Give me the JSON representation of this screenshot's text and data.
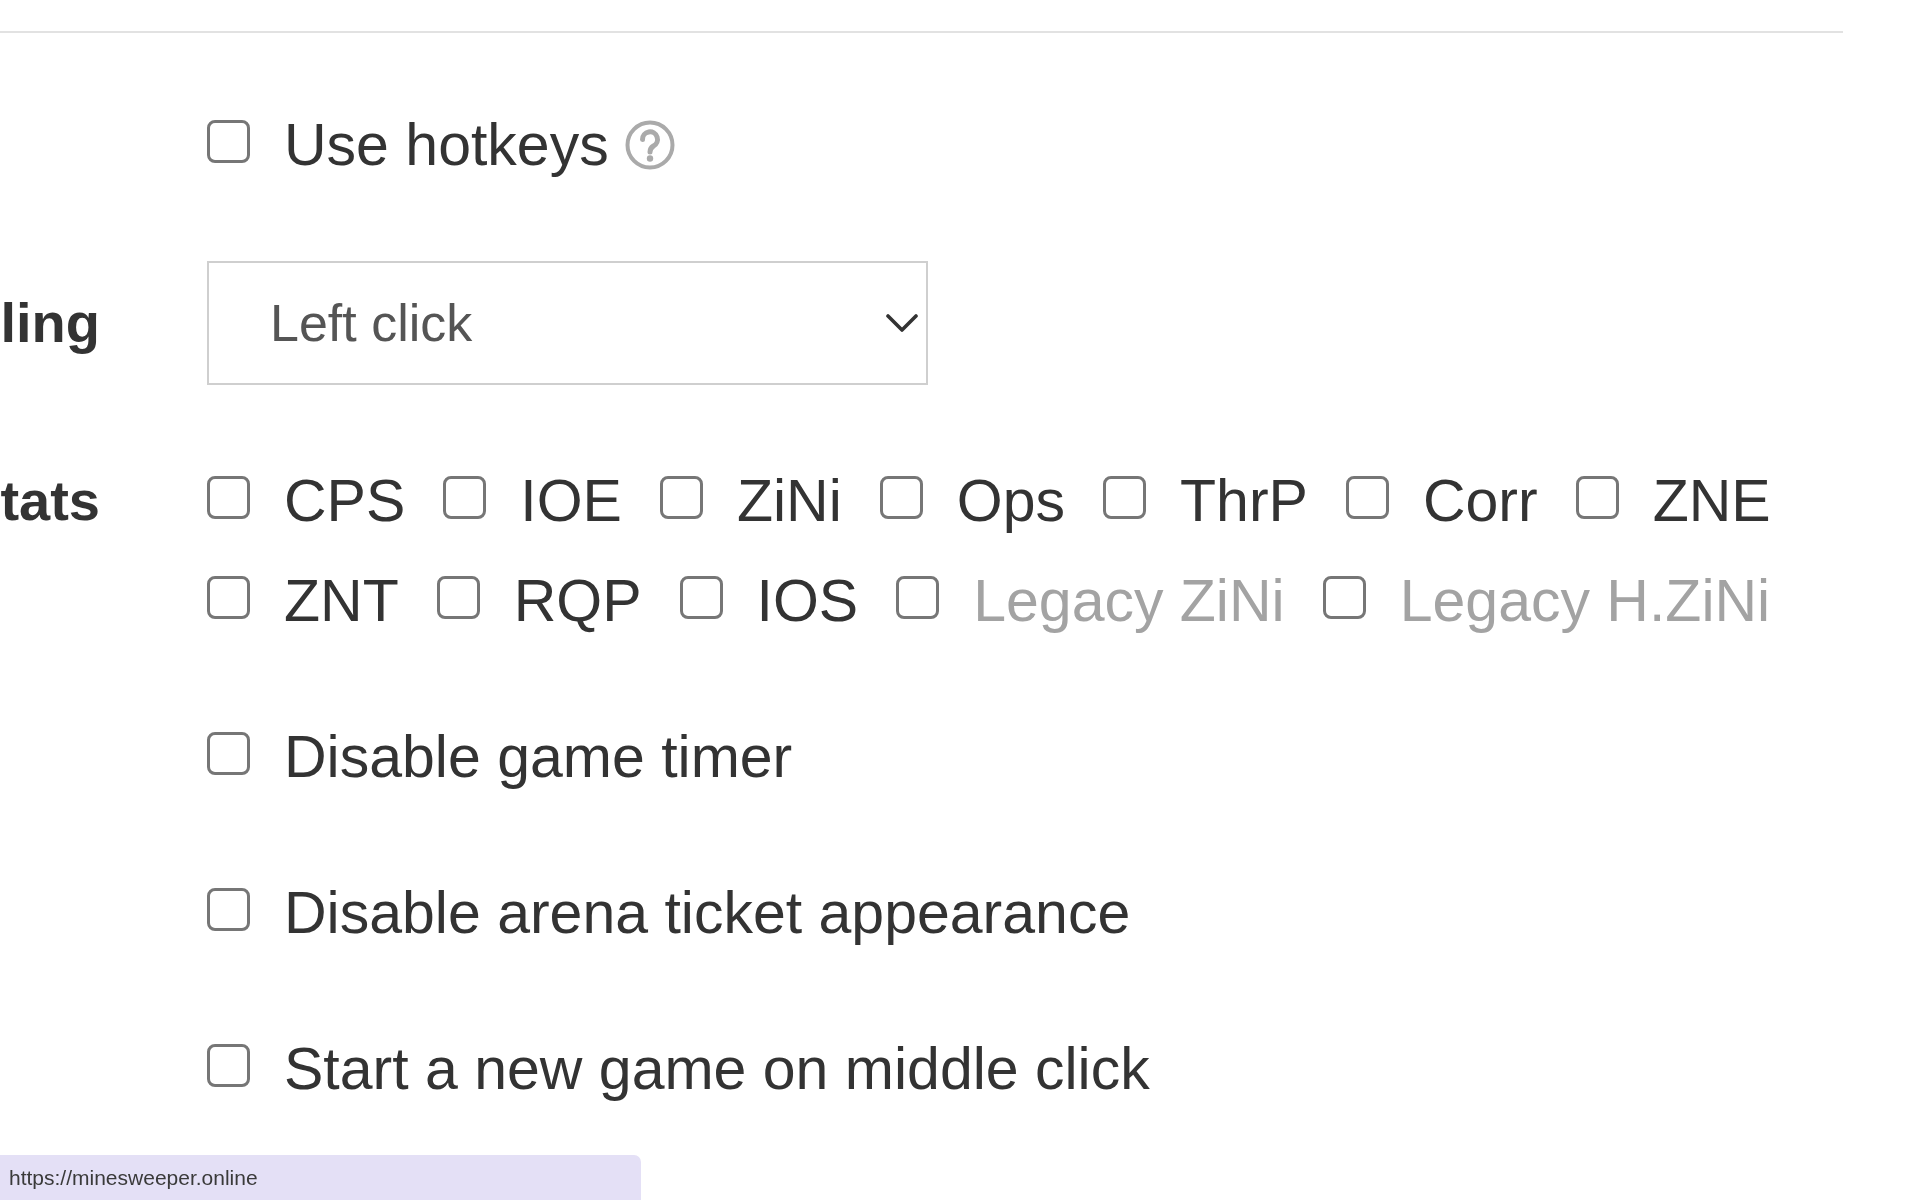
{
  "form": {
    "rows": [
      {
        "kind": "checkbox",
        "option": {
          "text": "Use hotkeys",
          "checked": false,
          "disabled": false
        },
        "help": true
      },
      {
        "kind": "dropdown",
        "label": "ling",
        "value": "Left click"
      },
      {
        "kind": "checkbox_group",
        "label": "tats",
        "options": [
          {
            "text": "CPS",
            "checked": false,
            "disabled": false
          },
          {
            "text": "IOE",
            "checked": false,
            "disabled": false
          },
          {
            "text": "ZiNi",
            "checked": false,
            "disabled": false
          },
          {
            "text": "Ops",
            "checked": false,
            "disabled": false
          },
          {
            "text": "ThrP",
            "checked": false,
            "disabled": false
          },
          {
            "text": "Corr",
            "checked": false,
            "disabled": false
          },
          {
            "text": "ZNE",
            "checked": false,
            "disabled": false
          },
          {
            "text": "ZNT",
            "checked": false,
            "disabled": false
          },
          {
            "text": "RQP",
            "checked": false,
            "disabled": false
          },
          {
            "text": "IOS",
            "checked": false,
            "disabled": false
          },
          {
            "text": "Legacy ZiNi",
            "checked": false,
            "disabled": true
          },
          {
            "text": "Legacy H.ZiNi",
            "checked": false,
            "disabled": true
          }
        ]
      },
      {
        "kind": "checkbox",
        "option": {
          "text": "Disable game timer",
          "checked": false,
          "disabled": false
        }
      },
      {
        "kind": "checkbox",
        "option": {
          "text": "Disable arena ticket appearance",
          "checked": false,
          "disabled": false
        }
      },
      {
        "kind": "checkbox",
        "option": {
          "text": "Start a new game on middle click",
          "checked": false,
          "disabled": false
        }
      }
    ]
  },
  "status_bar": {
    "url": "https://minesweeper.online"
  }
}
